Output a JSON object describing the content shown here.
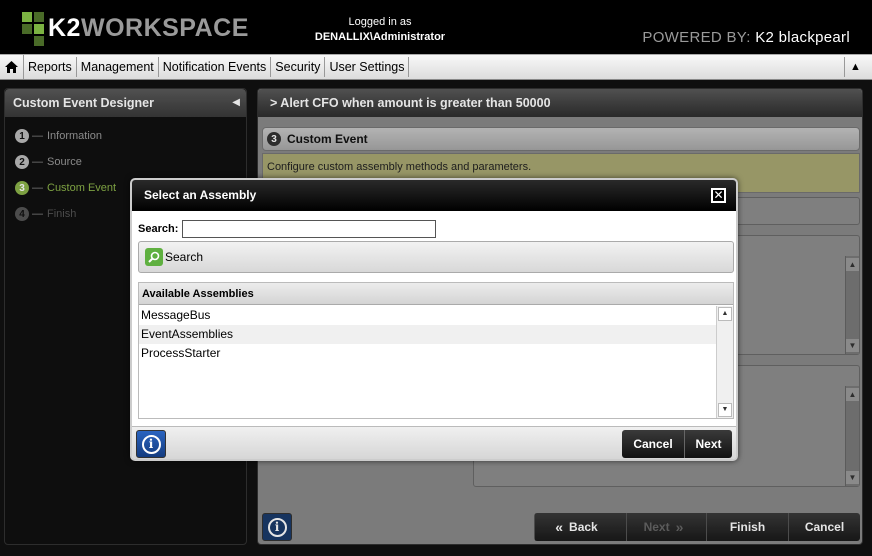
{
  "header": {
    "logo_k2": "K2",
    "logo_workspace": "WORKSPACE",
    "logged_in_label": "Logged in as",
    "user": "DENALLIX\\Administrator",
    "powered_label": "POWERED BY:",
    "powered_brand": "K2 blackpearl"
  },
  "menu": {
    "items": [
      "Reports",
      "Management",
      "Notification Events",
      "Security",
      "User Settings"
    ]
  },
  "left_panel": {
    "title": "Custom Event Designer",
    "steps": [
      {
        "num": "1",
        "label": "Information"
      },
      {
        "num": "2",
        "label": "Source"
      },
      {
        "num": "3",
        "label": "Custom Event"
      },
      {
        "num": "4",
        "label": "Finish"
      }
    ]
  },
  "right_panel": {
    "title": "> Alert CFO when amount is greater than 50000",
    "sub_header_num": "3",
    "sub_header": "Custom Event",
    "description": "Configure custom assembly methods and parameters.",
    "buttons": {
      "back": "Back",
      "next": "Next",
      "finish": "Finish",
      "cancel": "Cancel"
    }
  },
  "modal": {
    "title": "Select an Assembly",
    "search_label": "Search:",
    "search_value": "",
    "search_button": "Search",
    "list_header": "Available Assemblies",
    "items": [
      "MessageBus",
      "EventAssemblies",
      "ProcessStarter"
    ],
    "cancel": "Cancel",
    "next": "Next"
  }
}
